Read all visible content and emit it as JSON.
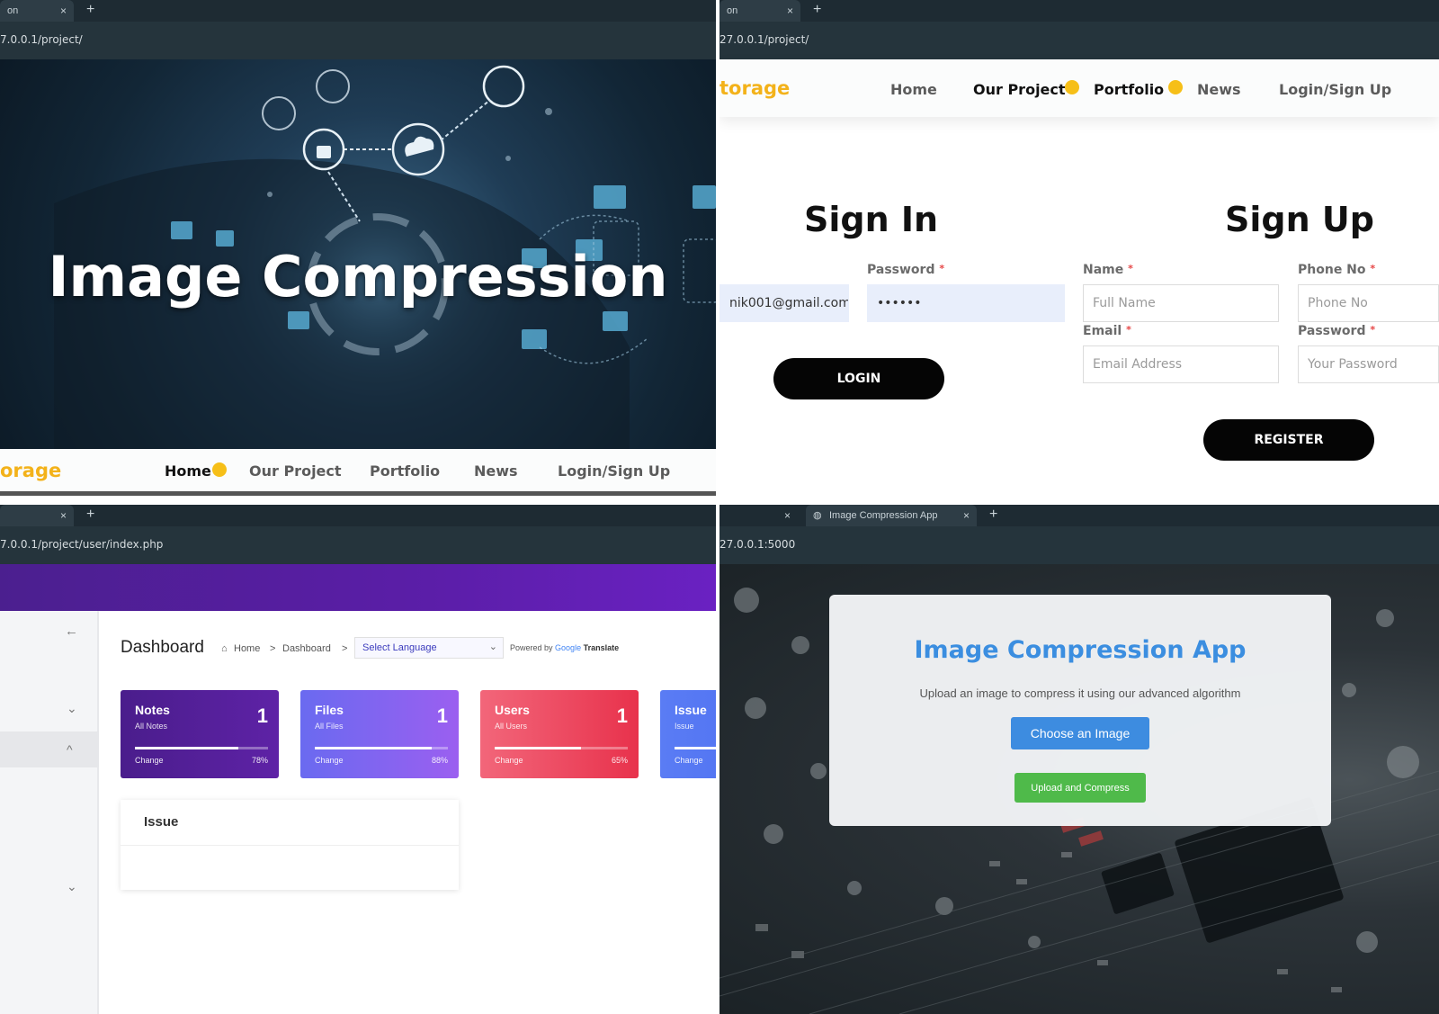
{
  "q1": {
    "tab_label": "on",
    "tab_close": "×",
    "tab_plus": "+",
    "address": "7.0.0.1/project/",
    "hero_title": "Image Compression",
    "nav": {
      "logo": "orage",
      "items": [
        "Home",
        "Our Project",
        "Portfolio",
        "News",
        "Login/Sign Up"
      ]
    }
  },
  "q2": {
    "tab_label": "on",
    "tab_close": "×",
    "tab_plus": "+",
    "address": "27.0.0.1/project/",
    "nav": {
      "logo": "torage",
      "items": [
        "Home",
        "Our Project",
        "Portfolio",
        "News",
        "Login/Sign Up"
      ]
    },
    "signin": {
      "title": "Sign In",
      "email_value": "nik001@gmail.com",
      "password_label": "Password",
      "password_value": "••••••",
      "login_label": "LOGIN"
    },
    "signup": {
      "title": "Sign Up",
      "name_label": "Name",
      "name_placeholder": "Full Name",
      "phone_label": "Phone No",
      "phone_placeholder": "Phone No",
      "email_label": "Email",
      "email_placeholder": "Email Address",
      "password_label": "Password",
      "password_placeholder": "Your Password",
      "register_label": "REGISTER"
    },
    "required_mark": "*"
  },
  "q3": {
    "tab_close": "×",
    "tab_plus": "+",
    "address": "7.0.0.1/project/user/index.php",
    "back_icon": "←",
    "chevron_down": "⌄",
    "chevron_up": "^",
    "dashboard_title": "Dashboard",
    "breadcrumb": {
      "home": "Home",
      "sep": ">",
      "current": "Dashboard"
    },
    "language_select": "Select Language",
    "powered_by": "Powered by",
    "google": "Google",
    "translate": "Translate",
    "cards": [
      {
        "name": "Notes",
        "sub": "All Notes",
        "count": "1",
        "change_label": "Change",
        "change_pct": "78%",
        "progress": 0.78,
        "color_from": "#4a1d8c",
        "color_to": "#5e22a6"
      },
      {
        "name": "Files",
        "sub": "All Files",
        "count": "1",
        "change_label": "Change",
        "change_pct": "88%",
        "progress": 0.88,
        "color_from": "#6a6af0",
        "color_to": "#9b5ff0"
      },
      {
        "name": "Users",
        "sub": "All Users",
        "count": "1",
        "change_label": "Change",
        "change_pct": "65%",
        "progress": 0.65,
        "color_from": "#f2667a",
        "color_to": "#e8324c"
      },
      {
        "name": "Issue",
        "sub": "Issue",
        "count": "",
        "change_label": "Change",
        "change_pct": "",
        "progress": 0.7,
        "color_from": "#5a7cf4",
        "color_to": "#4a6cf0"
      }
    ],
    "issue_panel_title": "Issue"
  },
  "q4": {
    "tab_close_left": "×",
    "tab_label": "Image Compression App",
    "tab_close": "×",
    "tab_plus": "+",
    "address": "27.0.0.1:5000",
    "app_title": "Image Compression App",
    "app_desc": "Upload an image to compress it using our advanced algorithm",
    "choose_label": "Choose an Image",
    "upload_label": "Upload and Compress"
  }
}
